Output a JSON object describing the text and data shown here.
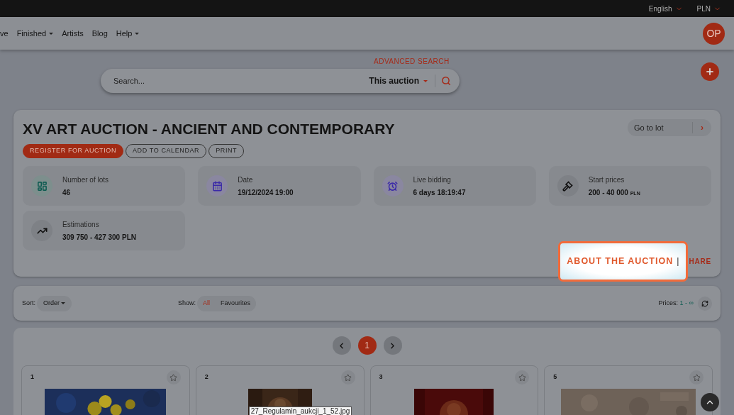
{
  "top_bar": {
    "language": "English",
    "currency": "PLN"
  },
  "nav": {
    "items": [
      {
        "label": "ve",
        "has_menu": false
      },
      {
        "label": "Finished",
        "has_menu": true
      },
      {
        "label": "Artists",
        "has_menu": false
      },
      {
        "label": "Blog",
        "has_menu": false
      },
      {
        "label": "Help",
        "has_menu": true
      }
    ],
    "avatar": "OP"
  },
  "advanced_search": "ADVANCED SEARCH",
  "search": {
    "placeholder": "Search...",
    "scope": "This auction"
  },
  "auction": {
    "title": "XV ART AUCTION - ANCIENT AND CONTEMPORARY",
    "buttons": [
      {
        "label": "REGISTER FOR AUCTION",
        "kind": "primary"
      },
      {
        "label": "ADD TO CALENDAR",
        "kind": "outline"
      },
      {
        "label": "PRINT",
        "kind": "outline"
      }
    ],
    "go_to_lot": {
      "placeholder": "Go to lot",
      "button": "›"
    },
    "stats": [
      {
        "kind": "lots",
        "label": "Number of lots",
        "value": "46"
      },
      {
        "kind": "date",
        "label": "Date",
        "value": "19/12/2024 19:00"
      },
      {
        "kind": "clock",
        "label": "Live bidding",
        "value": "6 days 18:19:47"
      },
      {
        "kind": "gavel",
        "label": "Start prices",
        "value": "200 - 40 000",
        "unit": "PLN"
      },
      {
        "kind": "trend",
        "label": "Estimations",
        "value": "309 750 - 427 300 PLN"
      }
    ],
    "about_link": {
      "label": "ABOUT THE AUCTION",
      "separator": "|",
      "highlighted": true
    },
    "share_link": "HARE"
  },
  "filters": {
    "sort_label": "Sort:",
    "sort_value": "Order",
    "show_label": "Show:",
    "show_options": [
      {
        "label": "All",
        "selected": true
      },
      {
        "label": "Favourites",
        "selected": false
      }
    ],
    "prices_label": "Prices:",
    "prices_value": "1 - ∞"
  },
  "pagination": {
    "pages": [
      {
        "label": "1",
        "selected": true
      }
    ]
  },
  "lots": [
    {
      "number": "1",
      "kind": "flowers"
    },
    {
      "number": "2",
      "kind": "portrait"
    },
    {
      "number": "3",
      "kind": "red"
    },
    {
      "number": "5",
      "kind": "stone"
    }
  ],
  "tooltip": "27_Regulamin_aukcji_1_52.jpg"
}
